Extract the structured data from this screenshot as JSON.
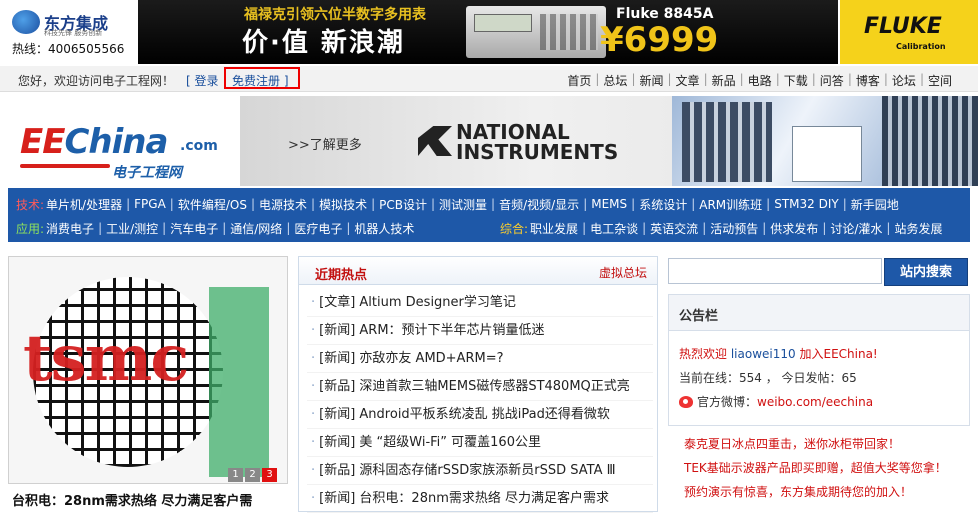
{
  "header": {
    "company_name": "东方集成",
    "company_slogan": "科技先锋 服务创新",
    "hotline": "热线：4006505566",
    "ad_headline": "福禄克引领六位半数字多用表",
    "ad_slogan": "价·值  新浪潮",
    "ad_model": "Fluke 8845A",
    "ad_price": "¥6999",
    "fluke_word": "FLUKE",
    "fluke_sub": "Calibration"
  },
  "login_bar": {
    "welcome": "您好，欢迎访问电子工程网！",
    "login_label": "[ 登录",
    "register_label": "免费注册 ]",
    "nav": [
      "首页",
      "总坛",
      "新闻",
      "文章",
      "新品",
      "电路",
      "下载",
      "问答",
      "博客",
      "论坛",
      "空间"
    ]
  },
  "logo": {
    "ee": "EE",
    "china": "China",
    "dotcom": ".com",
    "cn_name": "电子工程网"
  },
  "banner": {
    "more_label": ">>了解更多",
    "ni_line1": "NATIONAL",
    "ni_line2": "INSTRUMENTS"
  },
  "categories": {
    "row1_label": "技术:",
    "row1": [
      "单片机/处理器",
      "FPGA",
      "软件编程/OS",
      "电源技术",
      "模拟技术",
      "PCB设计",
      "测试测量",
      "音频/视频/显示",
      "MEMS",
      "系统设计",
      "ARM训练班",
      "STM32 DIY",
      "新手园地"
    ],
    "row2_label": "应用:",
    "row2": [
      "消费电子",
      "工业/测控",
      "汽车电子",
      "通信/网络",
      "医疗电子",
      "机器人技术"
    ],
    "row2b_label": "综合:",
    "row2b": [
      "职业发展",
      "电工杂谈",
      "英语交流",
      "活动预告",
      "供求发布",
      "讨论/灌水",
      "站务发展"
    ]
  },
  "feature": {
    "logo_text": "tsmc",
    "pages": [
      "1",
      "2",
      "3"
    ],
    "active_page": 3,
    "caption": "台积电：28nm需求热络 尽力满足客户需"
  },
  "hot": {
    "title": "近期热点",
    "more": "虚拟总坛",
    "items": [
      "[文章] Altium Designer学习笔记",
      "[新闻] ARM：预计下半年芯片销量低迷",
      "[新闻] 亦敌亦友 AMD+ARM=?",
      "[新品] 深迪首款三轴MEMS磁传感器ST480MQ正式亮",
      "[新闻] Android平板系统凌乱 挑战iPad还得看微软",
      "[新闻] 美 “超级Wi-Fi” 可覆盖160公里",
      "[新品] 源科固态存储rSSD家族添新员rSSD SATA Ⅲ",
      "[新闻] 台积电：28nm需求热络 尽力满足客户需求"
    ]
  },
  "search": {
    "placeholder": "",
    "button_label": "站内搜索"
  },
  "notice": {
    "title": "公告栏",
    "welcome_prefix": "热烈欢迎",
    "username": "liaowei110",
    "welcome_suffix": "加入EEChina!",
    "online": "当前在线：554 ，   今日发帖：65",
    "weibo_label": "官方微博：",
    "weibo_link": "weibo.com/eechina"
  },
  "promos": [
    "泰克夏日冰点四重击，迷你冰柜带回家！",
    "TEK基础示波器产品即买即赠，超值大奖等您拿！",
    "预约演示有惊喜，东方集成期待您的加入！"
  ],
  "colors": {
    "nav_blue": "#1e58a8",
    "accent_red": "#d01010",
    "link_blue": "#1a4f9c",
    "fluke_yellow": "#f5d21b"
  }
}
